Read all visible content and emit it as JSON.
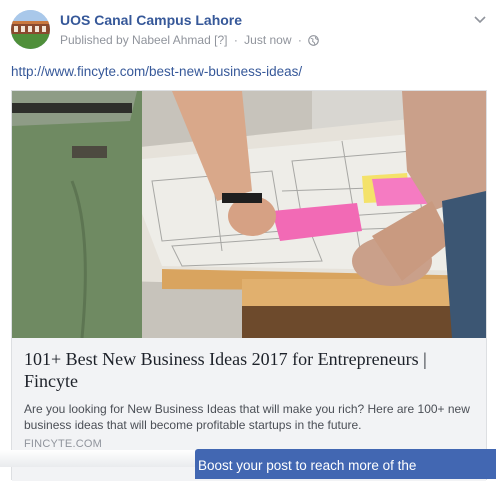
{
  "post": {
    "page_name": "UOS Canal Campus Lahore",
    "published_by": "Published by Nabeel Ahmad",
    "help_marker": "[?]",
    "separator": "·",
    "time": "Just now",
    "privacy_icon": "globe-icon",
    "options_icon": "chevron-down-icon",
    "link_text": "http://www.fincyte.com/best-new-business-ideas/"
  },
  "link_card": {
    "image_icon": "business-meeting-photo",
    "title": "101+ Best New Business Ideas 2017 for Entrepreneurs | Fincyte",
    "description": "Are you looking for New Business Ideas that will make you rich? Here are 100+ new business ideas that will become profitable startups in the future.",
    "domain": "FINCYTE.COM"
  },
  "boost": {
    "label": "Boost your post to reach more of the"
  },
  "colors": {
    "link_blue": "#365899",
    "boost_blue": "#4267b2",
    "card_bg": "#f2f3f5"
  }
}
